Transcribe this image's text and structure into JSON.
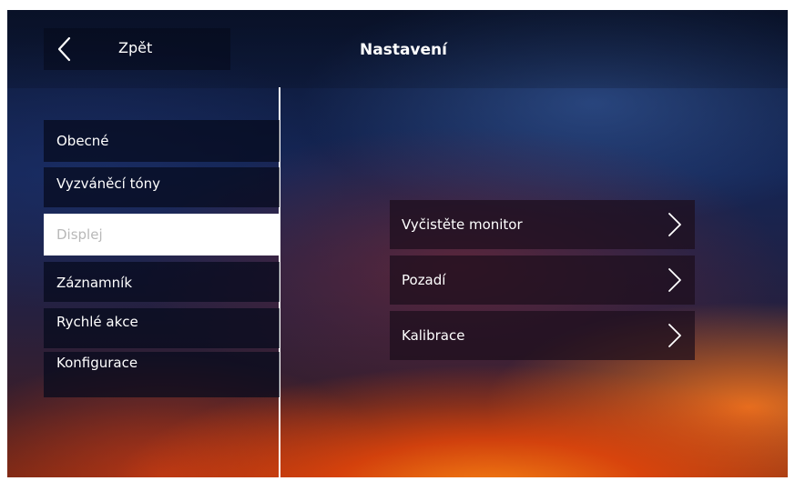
{
  "header": {
    "back_label": "Zpět",
    "title": "Nastavení"
  },
  "menu": {
    "items": [
      {
        "label": "Obecné"
      },
      {
        "label": "Vyzváněcí tóny"
      },
      {
        "label": "Displej",
        "active": true
      },
      {
        "label": "Záznamník"
      },
      {
        "label": "Rychlé akce"
      },
      {
        "label": "Konfigurace"
      }
    ]
  },
  "options": [
    {
      "label": "Vyčistěte monitor"
    },
    {
      "label": "Pozadí"
    },
    {
      "label": "Kalibrace"
    }
  ],
  "colors": {
    "text": "#ffffff",
    "active_bg": "#ffffff",
    "active_text": "#b8b8b8",
    "divider": "#ffffff"
  },
  "icons": {
    "back": "chevron-left-icon",
    "option_arrow": "chevron-right-icon"
  }
}
